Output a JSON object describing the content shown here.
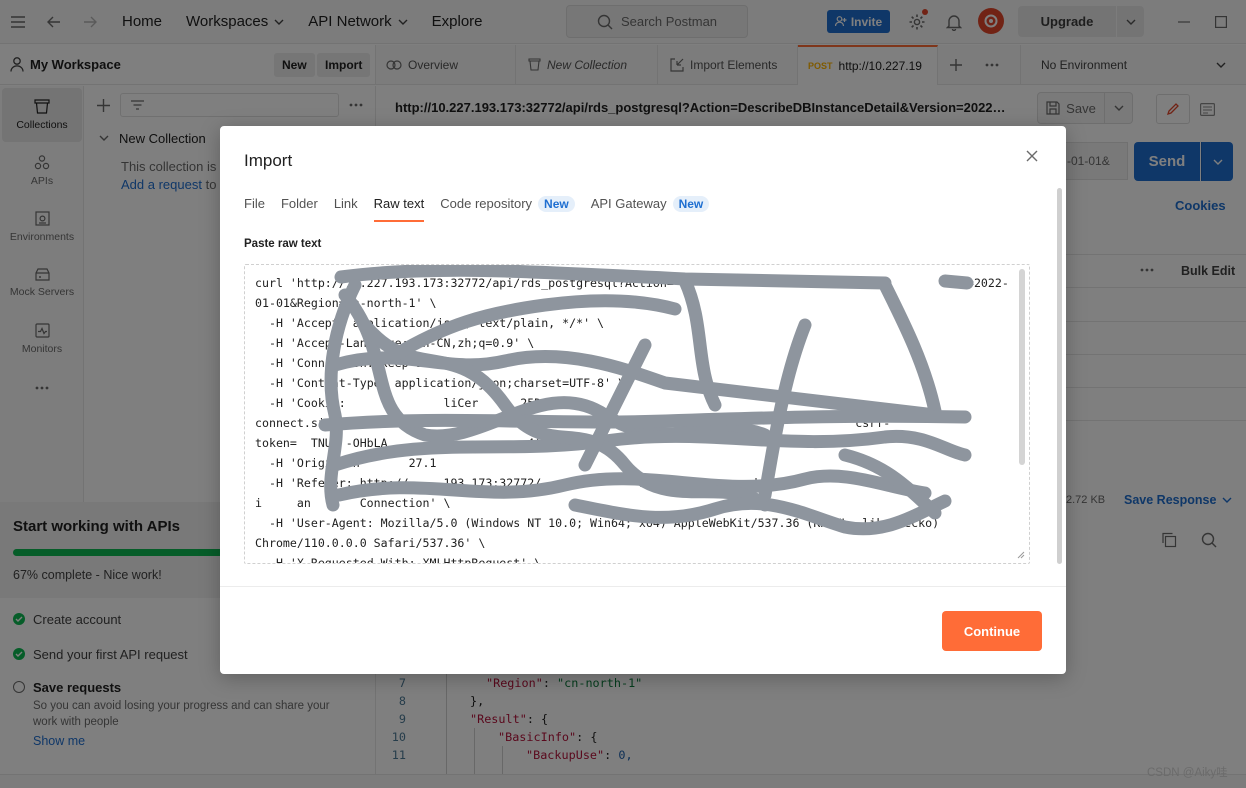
{
  "header": {
    "nav": [
      "Home",
      "Workspaces",
      "API Network",
      "Explore"
    ],
    "search_placeholder": "Search Postman",
    "invite_label": "Invite",
    "upgrade_label": "Upgrade"
  },
  "workspace": {
    "name": "My Workspace",
    "new_label": "New",
    "import_label": "Import"
  },
  "tabs": [
    {
      "label": "Overview",
      "icon": "overview-icon"
    },
    {
      "label": "New Collection",
      "icon": "collection-icon"
    },
    {
      "label": "Import Elements",
      "icon": "import-icon"
    },
    {
      "method": "POST",
      "label": "http://10.227.19"
    }
  ],
  "environment": {
    "label": "No Environment"
  },
  "leftnav": {
    "items": [
      {
        "label": "Collections",
        "icon": "collections-icon"
      },
      {
        "label": "APIs",
        "icon": "apis-icon"
      },
      {
        "label": "Environments",
        "icon": "environments-icon"
      },
      {
        "label": "Mock Servers",
        "icon": "mock-servers-icon"
      },
      {
        "label": "Monitors",
        "icon": "monitors-icon"
      }
    ]
  },
  "sidebar": {
    "collection_name": "New Collection",
    "empty_text": "This collection is",
    "add_request_link": "Add a request",
    "add_request_tail": "to"
  },
  "onboarding": {
    "title": "Start working with APIs",
    "progress": 0.67,
    "progress_text": "67% complete - Nice work!",
    "items": [
      {
        "label": "Create account",
        "done": true
      },
      {
        "label": "Send your first API request",
        "done": true
      },
      {
        "label": "Save requests",
        "done": false,
        "description": "So you can avoid losing your progress and can share your work with people",
        "link": "Show me"
      }
    ]
  },
  "request": {
    "url": "http://10.227.193.173:32772/api/rds_postgresql?Action=DescribeDBInstanceDetail&Version=2022-01-0...",
    "save_label": "Save",
    "url_tail": "-01-01&",
    "send_label": "Send",
    "cookies_label": "Cookies",
    "bulk_edit_label": "Bulk Edit",
    "response_size": "2.72 KB",
    "save_response_label": "Save Response"
  },
  "response_code": [
    {
      "n": "7",
      "indent": 2,
      "key": "\"Region\"",
      "sep": ": ",
      "str": "\"cn-north-1\""
    },
    {
      "n": "8",
      "indent": 1,
      "punct": "},"
    },
    {
      "n": "9",
      "indent": 1,
      "key": "\"Result\"",
      "sep": ": ",
      "punct2": "{"
    },
    {
      "n": "10",
      "indent": 2,
      "key": "\"BasicInfo\"",
      "sep": ": ",
      "punct2": "{"
    },
    {
      "n": "11",
      "indent": 3,
      "key": "\"BackupUse\"",
      "sep": ": ",
      "num": "0,"
    }
  ],
  "import_modal": {
    "title": "Import",
    "tabs": [
      {
        "label": "File"
      },
      {
        "label": "Folder"
      },
      {
        "label": "Link"
      },
      {
        "label": "Raw text",
        "active": true
      },
      {
        "label": "Code repository",
        "badge": "New"
      },
      {
        "label": "API Gateway",
        "badge": "New"
      }
    ],
    "paste_label": "Paste raw text",
    "raw_text": "curl 'http://10.227.193.173:32772/api/rds_postgresql?Action=                                       ion=2022-01-01&Region=cn-north-1' \\\n  -H 'Accept: application/json, text/plain, */*' \\\n  -H 'Accept-Language: zh-CN,zh;q=0.9' \\\n  -H 'Connection: keep-alive' \\\n  -H 'Content-Type: application/json;charset=UTF-8' \\\n  -H 'Cookie:              liCer      25Dpt8xEU;\nconnect.sid=s%3AoJzR5D                 Eq.Fc                                          csrf-\ntoken=  TNU  -OHbLA                    4' \\\n  -H 'Origin: h       27.1\n  -H 'Referer: http://     193.173:32772/              stgres          dd\ni     an       Connection' \\\n  -H 'User-Agent: Mozilla/5.0 (Windows NT 10.0; Win64; x64) AppleWebKit/537.36 (KHTML, like Gecko)\nChrome/110.0.0.0 Safari/537.36' \\\n  -H 'X-Requested-With: XMLHttpRequest' \\",
    "continue_label": "Continue"
  },
  "watermark": "CSDN @Aiky哇",
  "colors": {
    "accent": "#ff6c37",
    "primary": "#1f6fd1",
    "success": "#0cbb52",
    "scribble": "#8e959e"
  }
}
